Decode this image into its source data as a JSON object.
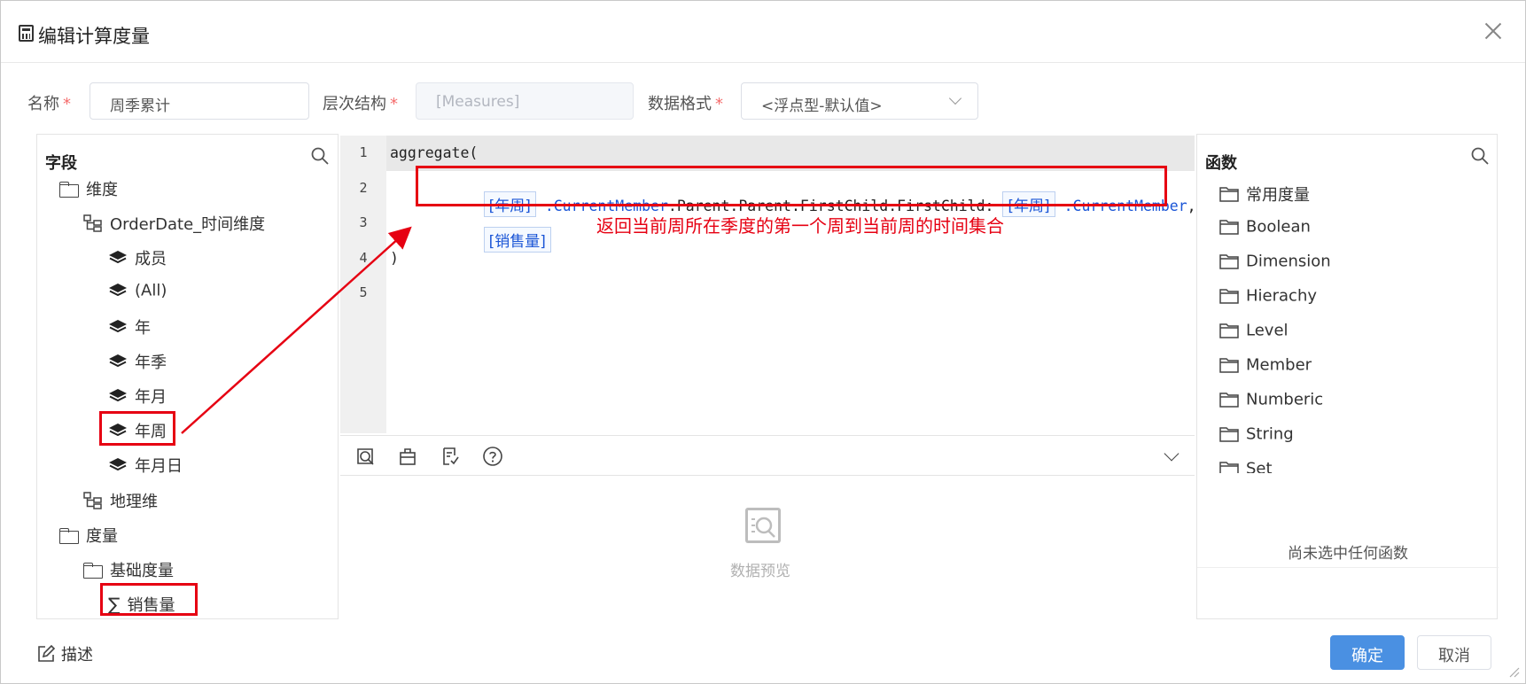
{
  "dialog": {
    "title": "编辑计算度量"
  },
  "form": {
    "name_label": "名称",
    "name_value": "周季累计",
    "hierarchy_label": "层次结构",
    "hierarchy_value": "[Measures]",
    "format_label": "数据格式",
    "format_value": "<浮点型-默认值>",
    "required_mark": "*"
  },
  "fields_panel": {
    "title": "字段",
    "tree": {
      "dimensions": "维度",
      "orderdate": "OrderDate_时间维度",
      "levels": [
        "成员",
        "(All)",
        "年",
        "年季",
        "年月",
        "年周",
        "年月日"
      ],
      "geo": "地理维",
      "measures": "度量",
      "basic_measures": "基础度量",
      "sales": "销售量"
    }
  },
  "editor": {
    "line_numbers": [
      "1",
      "2",
      "3",
      "4",
      "5"
    ],
    "line1": "aggregate(",
    "line2_tag1": "[年周]",
    "line2_member1": ".CurrentMember",
    "line2_mid": ".Parent.Parent.FirstChild.FirstChild:",
    "line2_tag2": "[年周]",
    "line2_member2": ".CurrentMember",
    "line2_end": ",",
    "line3_tag": "[销售量]",
    "line4": ")"
  },
  "annotation": "返回当前周所在季度的第一个周到当前周的时间集合",
  "preview": {
    "empty_text": "数据预览"
  },
  "functions_panel": {
    "title": "函数",
    "folders": [
      "常用度量",
      "Boolean",
      "Dimension",
      "Hierachy",
      "Level",
      "Member",
      "Numberic",
      "String",
      "Set"
    ],
    "empty_text": "尚未选中任何函数"
  },
  "footer": {
    "describe_label": "描述",
    "ok_label": "确定",
    "cancel_label": "取消"
  },
  "colors": {
    "accent": "#4a90e2",
    "highlight": "#e60012",
    "code_keyword": "#1a55d6"
  }
}
